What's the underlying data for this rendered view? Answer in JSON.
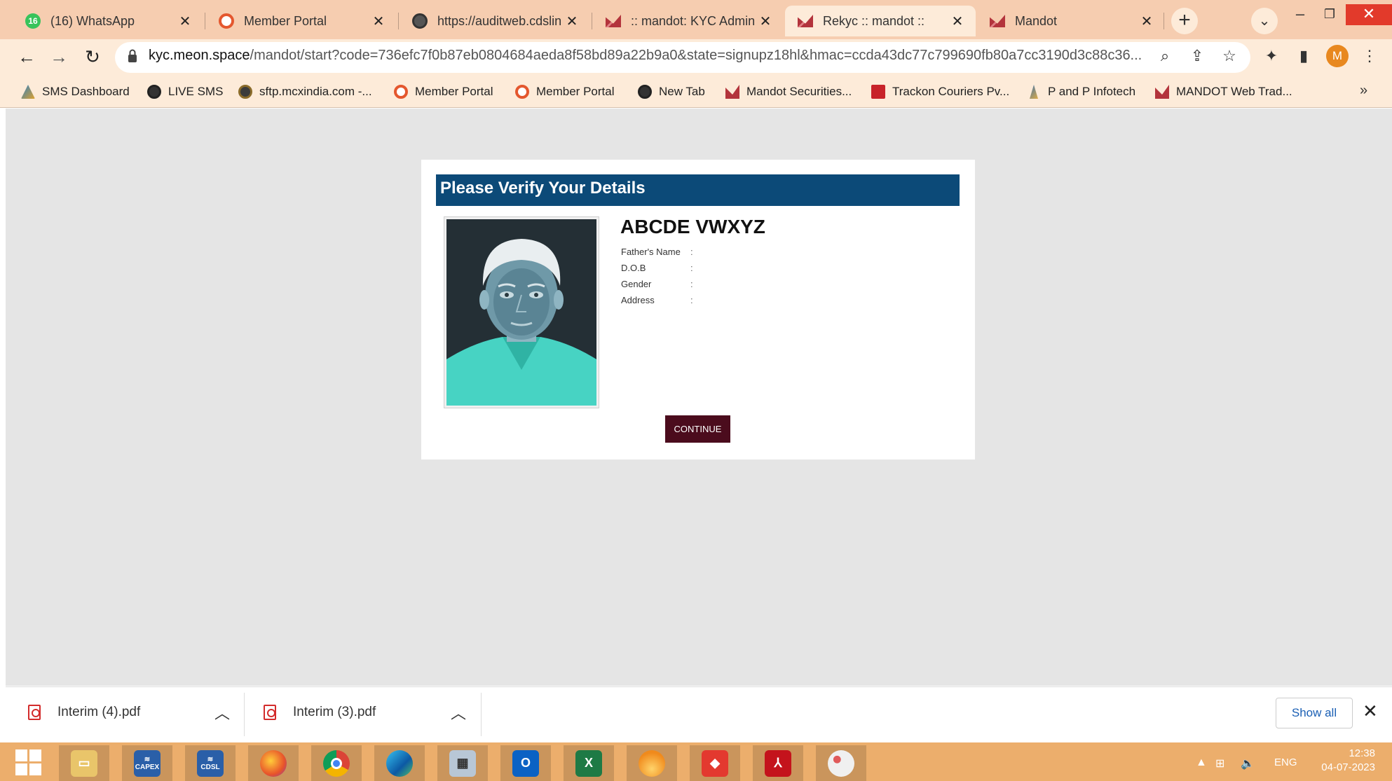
{
  "browser": {
    "tabs": [
      {
        "title": "(16) WhatsApp",
        "icon": "whatsapp-icon",
        "badge": "16"
      },
      {
        "title": "Member Portal",
        "icon": "portal-icon"
      },
      {
        "title": "https://auditweb.cdslin",
        "icon": "globe-icon"
      },
      {
        "title": ":: mandot: KYC Admin ::",
        "icon": "mandot-icon"
      },
      {
        "title": "Rekyc :: mandot ::",
        "icon": "mandot-icon",
        "active": true
      },
      {
        "title": "Mandot",
        "icon": "mandot-icon"
      }
    ],
    "address": {
      "host": "kyc.meon.space",
      "path": "/mandot/start?code=736efc7f0b87eb0804684aeda8f58bd89a22b9a0&state=signupz18hl&hmac=ccda43dc77c799690fb80a7cc3190d3c88c36..."
    },
    "profile_initial": "M",
    "bookmarks": [
      {
        "label": "SMS Dashboard",
        "icon": "sms-icon"
      },
      {
        "label": "LIVE SMS",
        "icon": "globe-icon"
      },
      {
        "label": "sftp.mcxindia.com -...",
        "icon": "sftp-icon"
      },
      {
        "label": "Member Portal",
        "icon": "portal-icon"
      },
      {
        "label": "Member Portal",
        "icon": "portal-icon"
      },
      {
        "label": "New Tab",
        "icon": "globe-icon"
      },
      {
        "label": "Mandot Securities...",
        "icon": "mandot-icon"
      },
      {
        "label": "Trackon Couriers Pv...",
        "icon": "trackon-icon"
      },
      {
        "label": "P and P Infotech",
        "icon": "infotech-icon"
      },
      {
        "label": "MANDOT Web Trad...",
        "icon": "mandot-icon"
      }
    ],
    "bookmarks_more": "»"
  },
  "kyc": {
    "header_title": "Please Verify Your Details",
    "name": "ABCDE VWXYZ",
    "fields": [
      {
        "label": "Father's Name",
        "value": ":"
      },
      {
        "label": "D.O.B",
        "value": ":"
      },
      {
        "label": "Gender",
        "value": ":"
      },
      {
        "label": "Address",
        "value": ":"
      }
    ],
    "continue_label": "CONTINUE",
    "header_color": "#0c4a78",
    "button_color": "#4b0c1d"
  },
  "downloads": {
    "items": [
      {
        "name": "Interim (4).pdf"
      },
      {
        "name": "Interim (3).pdf"
      }
    ],
    "show_all_label": "Show all"
  },
  "taskbar": {
    "apps": [
      "file-explorer-icon",
      "capex-icon",
      "cdsl-icon",
      "firefox-icon",
      "chrome-icon",
      "edge-icon",
      "calculator-icon",
      "outlook-icon",
      "excel-icon",
      "app-flame-icon",
      "anydesk-icon",
      "acrobat-icon",
      "paint-icon"
    ],
    "capex_label": "CAPEX",
    "cdsl_label": "CDSL",
    "language": "ENG",
    "time": "12:38",
    "date": "04-07-2023"
  }
}
